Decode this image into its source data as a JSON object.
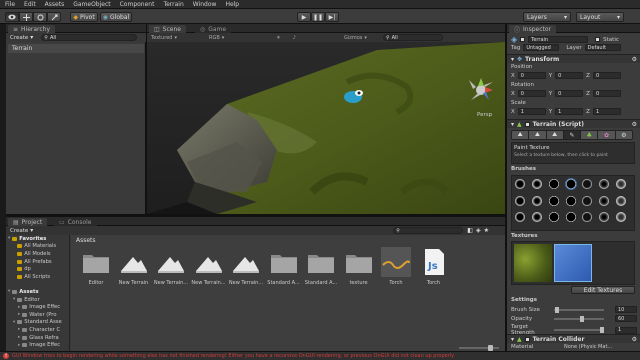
{
  "menu": [
    "File",
    "Edit",
    "Assets",
    "GameObject",
    "Component",
    "Terrain",
    "Window",
    "Help"
  ],
  "toolbar": {
    "pivot": "Pivot",
    "global": "Global",
    "layers": "Layers",
    "layout": "Layout"
  },
  "hierarchy": {
    "tab": "Hierarchy",
    "create": "Create",
    "search": "All",
    "items": [
      "Terrain"
    ]
  },
  "scene": {
    "tab_scene": "Scene",
    "tab_game": "Game",
    "render_mode": "Textured",
    "color_mode": "RGB",
    "gizmos": "Gizmos",
    "search": "All",
    "persp": "Persp"
  },
  "project": {
    "tab_project": "Project",
    "tab_console": "Console",
    "create": "Create",
    "tree": [
      {
        "label": "Favorites",
        "kind": "header"
      },
      {
        "label": "All Materials",
        "kind": "fav"
      },
      {
        "label": "All Models",
        "kind": "fav"
      },
      {
        "label": "All Prefabs",
        "kind": "fav"
      },
      {
        "label": "dp",
        "kind": "fav"
      },
      {
        "label": "All Scripts",
        "kind": "fav"
      },
      {
        "label": "",
        "kind": "spacer"
      },
      {
        "label": "Assets",
        "kind": "header"
      },
      {
        "label": "Editor",
        "kind": "folder"
      },
      {
        "label": "Image Effec",
        "kind": "folder2"
      },
      {
        "label": "Water (Pro",
        "kind": "folder2"
      },
      {
        "label": "Standard Asse",
        "kind": "folder"
      },
      {
        "label": "Character C",
        "kind": "folder2"
      },
      {
        "label": "Glass Refra",
        "kind": "folder2"
      },
      {
        "label": "Image Effec",
        "kind": "folder2"
      }
    ],
    "breadcrumb": "Assets",
    "assets": [
      {
        "label": "Editor",
        "kind": "folder"
      },
      {
        "label": "New Terrain",
        "kind": "terrain"
      },
      {
        "label": "New Terrain...",
        "kind": "terrain"
      },
      {
        "label": "New Terrain...",
        "kind": "terrain"
      },
      {
        "label": "New Terrain...",
        "kind": "terrain"
      },
      {
        "label": "Standard A...",
        "kind": "folder"
      },
      {
        "label": "Standard A...",
        "kind": "folder"
      },
      {
        "label": "texture",
        "kind": "folder"
      },
      {
        "label": "Torch",
        "kind": "torch"
      },
      {
        "label": "Torch",
        "kind": "js"
      }
    ]
  },
  "inspector": {
    "tab": "Inspector",
    "object_name": "Terrain",
    "static_label": "Static",
    "tag_label": "Tag",
    "tag_value": "Untagged",
    "layer_label": "Layer",
    "layer_value": "Default",
    "transform": "Transform",
    "position": "Position",
    "rotation": "Rotation",
    "scale": "Scale",
    "pos": [
      "0",
      "0",
      "0"
    ],
    "rot": [
      "0",
      "0",
      "0"
    ],
    "scl": [
      "1",
      "1",
      "1"
    ],
    "terrain_script": "Terrain (Script)",
    "paint_title": "Paint Texture",
    "paint_hint": "Select a texture below, then click to paint",
    "brushes": "Brushes",
    "textures": "Textures",
    "edit_textures": "Edit Textures",
    "settings": "Settings",
    "brush_size_label": "Brush Size",
    "brush_size": "10",
    "opacity_label": "Opacity",
    "opacity": "60",
    "target_strength_label": "Target Strength",
    "target_strength": "1",
    "brush_size_fraction": 0.1,
    "opacity_fraction": 0.6,
    "target_strength_fraction": 1,
    "terrain_collider": "Terrain Collider",
    "material_label": "Material",
    "material_value": "None (Physic Mat..."
  },
  "status": {
    "message": "GUI Window tries to begin rendering while something else has not finished rendering! Either you have a recursive OnGUI rendering, or previous OnGUI did not clean up properly."
  },
  "colors": {
    "error": "#d23b3b",
    "selection": "#3d6ea8"
  }
}
